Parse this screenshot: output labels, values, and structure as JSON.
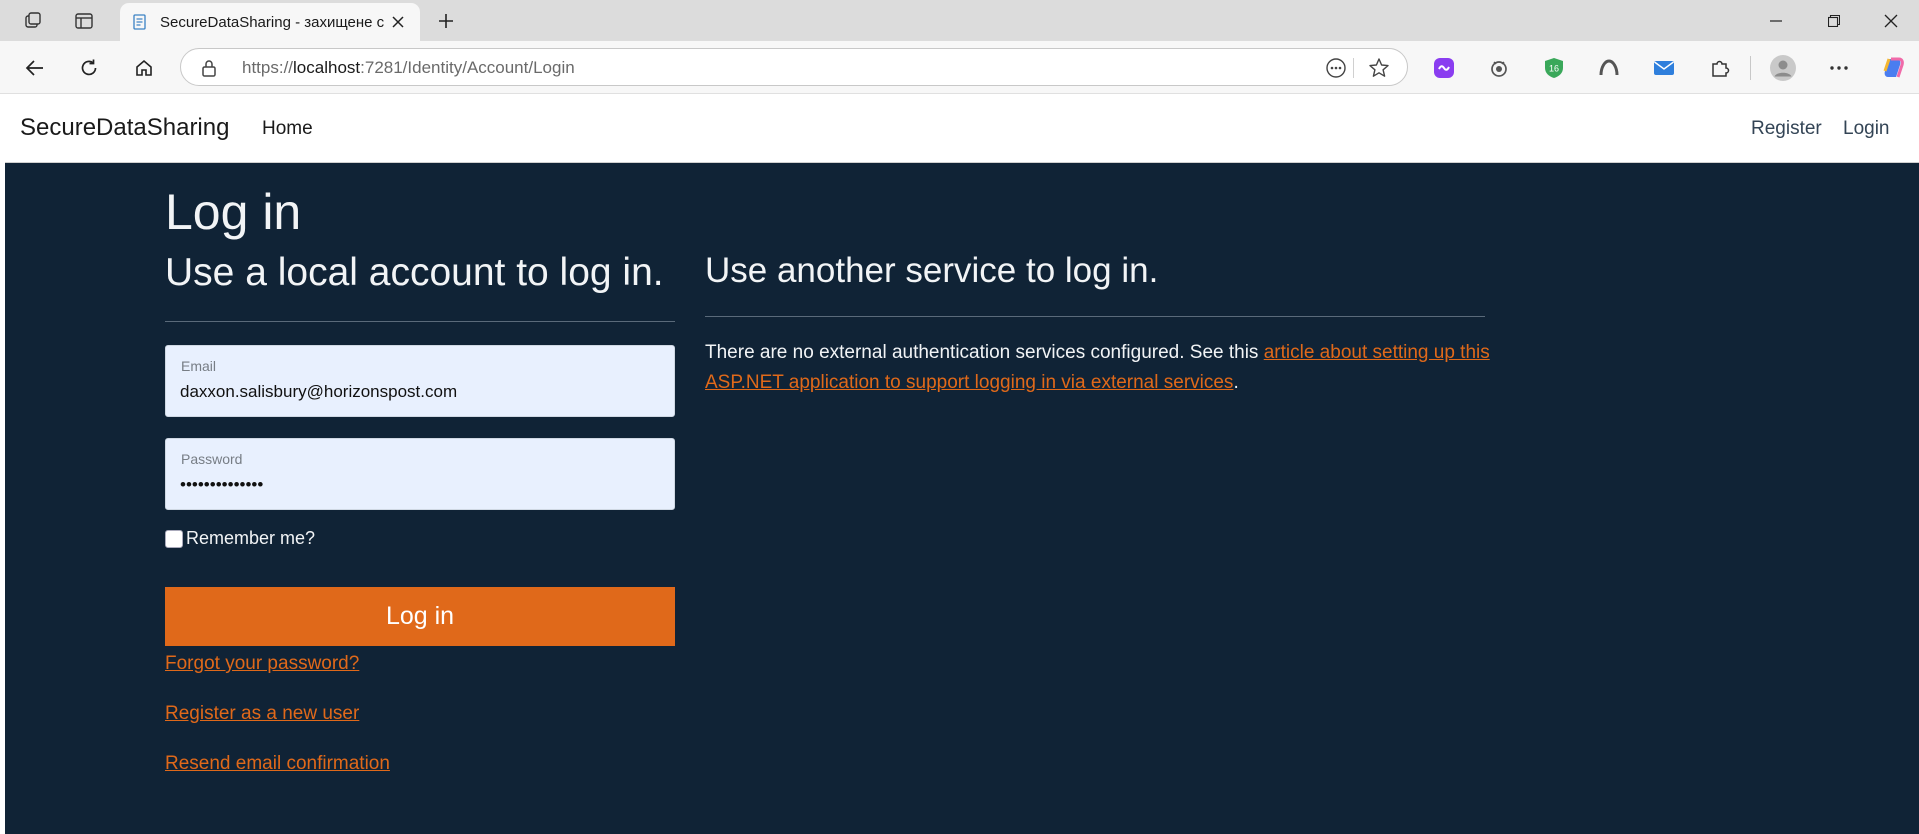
{
  "browser": {
    "tab_title": "SecureDataSharing - захищене с",
    "url_prefix": "https://",
    "url_host": "localhost",
    "url_path": ":7281/Identity/Account/Login"
  },
  "nav": {
    "brand": "SecureDataSharing",
    "home": "Home",
    "register": "Register",
    "login": "Login"
  },
  "main": {
    "title": "Log in",
    "local_heading": "Use a local account to log in.",
    "external_heading": "Use another service to log in.",
    "email_label": "Email",
    "email_value": "daxxon.salisbury@horizonspost.com",
    "password_label": "Password",
    "password_value": "••••••••••••••",
    "remember_label": "Remember me?",
    "login_button": "Log in",
    "forgot_link": "Forgot your password?",
    "register_link": "Register as a new user",
    "resend_link": "Resend email confirmation",
    "external_text_before": "There are no external authentication services configured. See this ",
    "external_link": "article about setting up this ASP.NET application to support logging in via external services",
    "external_text_after": "."
  },
  "colors": {
    "accent": "#e0691a",
    "content_bg": "#102336",
    "input_bg": "#e8f0fe"
  }
}
